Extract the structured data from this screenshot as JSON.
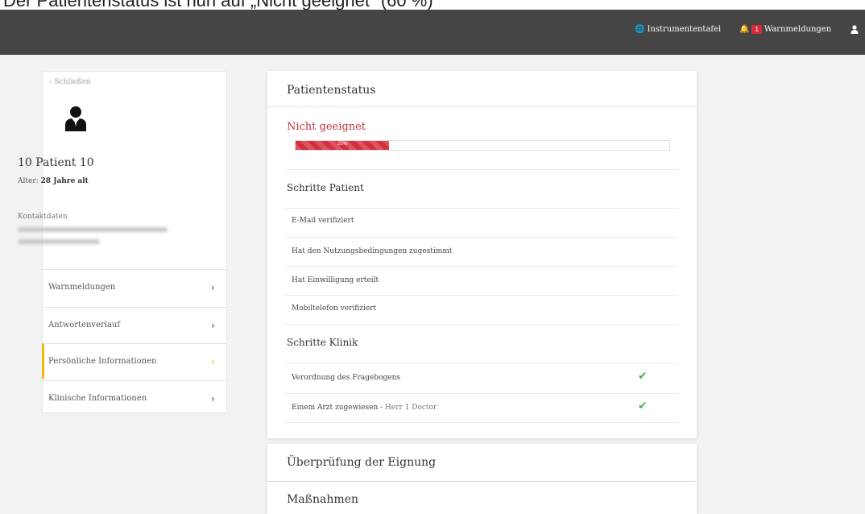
{
  "caption": {
    "text": "Der Patientenstatus ist nun auf „Nicht geeignet\" (60 %)"
  },
  "topbar": {
    "dashboard_label": "Instrumententafel",
    "alerts_badge": "1",
    "alerts_label": "Warnmeldungen"
  },
  "sidebar": {
    "back_label": "Schließen",
    "patient_name": "10 Patient 10",
    "age_label": "Alter:",
    "age_value": "28 Jahre alt",
    "contact_label": "Kontaktdaten",
    "menu": [
      {
        "label": "Warnmeldungen"
      },
      {
        "label": "Antwortenverlauf"
      },
      {
        "label": "Persönliche Informationen"
      },
      {
        "label": "Klinische Informationen"
      }
    ],
    "active_color": "#f6b80a"
  },
  "status_card": {
    "title": "Patientenstatus",
    "status": "Nicht geeignet",
    "status_color": "#c9303d",
    "progress_percent": 25,
    "progress_label": "25%",
    "patient_steps_title": "Schritte Patient",
    "patient_steps": [
      {
        "label": "E-Mail verifiziert"
      },
      {
        "label": "Hat den Nutzungsbedingungen zugestimmt"
      },
      {
        "label": "Hat Einwilligung erteilt"
      },
      {
        "label": "Mobiltelefon verifiziert"
      }
    ],
    "clinic_steps_title": "Schritte Klinik",
    "clinic_steps": [
      {
        "label": "Verordnung des Fragebogens",
        "done": true
      },
      {
        "label": "Einem Arzt zugewiesen",
        "doctor": "Herr 1 Doctor",
        "done": true
      }
    ],
    "check_color": "#4caf50"
  },
  "eligibility_card": {
    "title": "Überprüfung der Eignung"
  },
  "measures_card": {
    "title": "Maßnahmen"
  }
}
